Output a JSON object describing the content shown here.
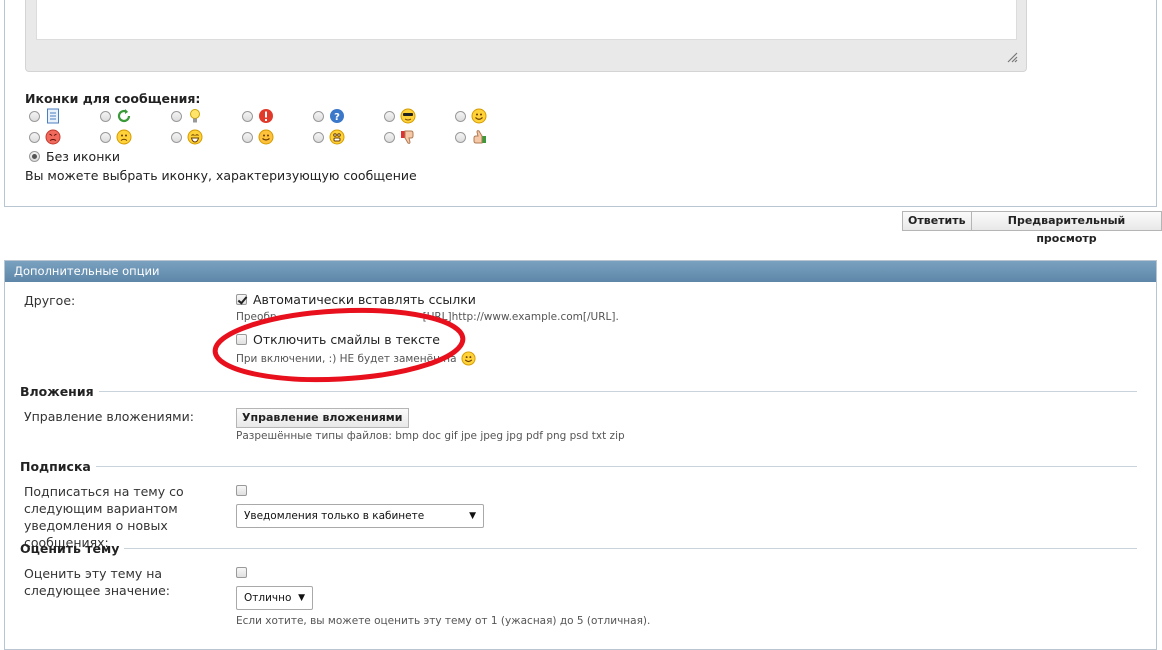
{
  "icons_section": {
    "title": "Иконки для сообщения:",
    "no_icon_label": "Без иконки",
    "hint": "Вы можете выбрать иконку, характеризующую сообщение",
    "icons": [
      [
        "document-icon",
        "refresh-icon",
        "lightbulb-icon",
        "exclamation-icon",
        "question-icon",
        "cool-smiley-icon",
        "smile-icon"
      ],
      [
        "angry-smiley-icon",
        "frown-smiley-icon",
        "laugh-smiley-icon",
        "grin-smiley-icon",
        "surprised-smiley-icon",
        "thumbs-down-icon",
        "thumbs-up-icon"
      ]
    ]
  },
  "buttons": {
    "reply": "Ответить",
    "preview": "Предварительный просмотр"
  },
  "options": {
    "header": "Дополнительные опции",
    "other_label": "Другое:",
    "auto_links_label": "Автоматически вставлять ссылки",
    "auto_links_hint_prefix": "Преобр",
    "auto_links_hint_suffix": "[URL]http://www.example.com[/URL].",
    "disable_smilies_label": "Отключить смайлы в тексте",
    "disable_smilies_hint": "При включении, :) НЕ будет заменён на"
  },
  "attachments": {
    "title": "Вложения",
    "label": "Управление вложениями:",
    "button": "Управление вложениями",
    "types_hint": "Разрешённые типы файлов: bmp doc gif jpe jpeg jpg pdf png psd txt zip"
  },
  "subscription": {
    "title": "Подписка",
    "label": "Подписаться на тему со следующим вариантом уведомления о новых сообщениях:",
    "select_value": "Уведомления только в кабинете"
  },
  "rating": {
    "title": "Оценить тему",
    "label": "Оценить эту тему на следующее значение:",
    "select_value": "Отлично",
    "hint": "Если хотите, вы можете оценить эту тему от 1 (ужасная) до 5 (отличная)."
  },
  "colors": {
    "header_bg": "#6a93b4",
    "annotation_red": "#e8101c"
  }
}
